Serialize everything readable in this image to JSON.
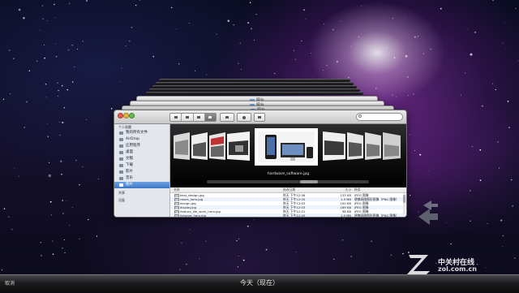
{
  "timeline": {
    "cancel_label": "取消",
    "current_label": "今天（现在）"
  },
  "stack": {
    "folder_label": "图片"
  },
  "finder": {
    "sidebar": {
      "sections": [
        {
          "title": "个人收藏",
          "items": [
            "我的所有文件",
            "AirDrop",
            "应用程序",
            "桌面",
            "文稿",
            "下载",
            "影片",
            "音乐",
            "图片"
          ]
        },
        {
          "title": "共享",
          "items": []
        },
        {
          "title": "设备",
          "items": []
        }
      ],
      "selected": "图片"
    },
    "coverflow": {
      "caption": "hardware_software.jpg"
    },
    "list": {
      "headers": {
        "name": "名称",
        "date": "修改日期",
        "size": "大小",
        "kind": "种类"
      },
      "rows": [
        {
          "name": "best_design.jpg",
          "date": "昨天 下午12:06",
          "size": "133 KB",
          "kind": "JPEG 图像"
        },
        {
          "name": "cases_hero.jpg",
          "date": "昨天 下午12:05",
          "size": "1.9 MB",
          "kind": "便携网络图形图像（PNG 图像）"
        },
        {
          "name": "design.jpg",
          "date": "昨天 下午12:03",
          "size": "100 KB",
          "kind": "JPEG 图像"
        },
        {
          "name": "display.jpg",
          "date": "昨天 下午12:03",
          "size": "169 KB",
          "kind": "JPEG 图像"
        },
        {
          "name": "feature_life_work_hero.jpg",
          "date": "昨天 下午12:01",
          "size": "98 KB",
          "kind": "JPEG 图像"
        },
        {
          "name": "forward_hero.jpg",
          "date": "昨天 下午12:05",
          "size": "1.9 MB",
          "kind": "便携网络图形图像（PNG 图像）"
        },
        {
          "name": "hardware_software.jpg",
          "date": "昨天 下午12:06",
          "size": "124 KB",
          "kind": "JPEG 图像"
        }
      ],
      "selected_index": 6
    }
  },
  "watermark": {
    "brand": "中关村在线",
    "url": "zol.com.cn"
  },
  "colors": {
    "selection": "#3875d7",
    "sidebar_selection": "#4a86d4",
    "nebula": "#a040c8"
  }
}
